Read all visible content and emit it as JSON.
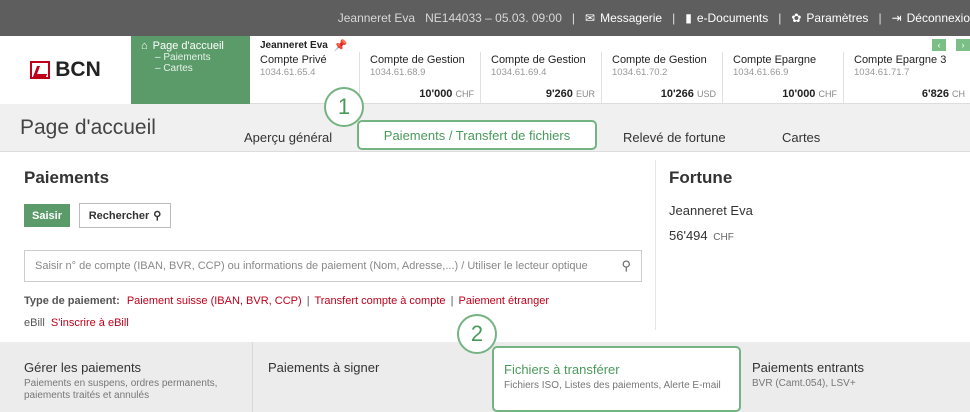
{
  "topbar": {
    "user": "Jeanneret Eva",
    "session": "NE144033 – 05.03. 09:00",
    "messaging": "Messagerie",
    "edocs": "e-Documents",
    "settings": "Paramètres",
    "logout": "Déconnexio"
  },
  "logo": {
    "text": "BCN"
  },
  "greennav": {
    "home": "Page d'accueil",
    "sub1": "– Paiements",
    "sub2": "– Cartes"
  },
  "accounts": {
    "holder": "Jeanneret Eva",
    "items": [
      {
        "name": "Compte Privé",
        "number": "1034.61.65.4",
        "balance": "",
        "currency": ""
      },
      {
        "name": "Compte de Gestion",
        "number": "1034.61.68.9",
        "balance": "10'000",
        "currency": "CHF"
      },
      {
        "name": "Compte de Gestion",
        "number": "1034.61.69.4",
        "balance": "9'260",
        "currency": "EUR"
      },
      {
        "name": "Compte de Gestion",
        "number": "1034.61.70.2",
        "balance": "10'266",
        "currency": "USD"
      },
      {
        "name": "Compte Epargne",
        "number": "1034.61.66.9",
        "balance": "10'000",
        "currency": "CHF"
      },
      {
        "name": "Compte Epargne 3",
        "number": "1034.61.71.7",
        "balance": "6'826",
        "currency": "CH"
      }
    ]
  },
  "page": {
    "title": "Page d'accueil",
    "tabs": {
      "overview": "Aperçu général",
      "payments": "Paiements / Transfert de fichiers",
      "wealth": "Relevé de fortune",
      "cards": "Cartes"
    }
  },
  "payments": {
    "heading": "Paiements",
    "saisir": "Saisir",
    "rechercher": "Rechercher",
    "search_placeholder": "Saisir n° de compte (IBAN, BVR, CCP) ou informations de paiement (Nom, Adresse,...) / Utiliser le lecteur optique",
    "type_label": "Type de paiement:",
    "type_swiss": "Paiement suisse (IBAN, BVR, CCP)",
    "type_transfer": "Transfert compte à compte",
    "type_foreign": "Paiement étranger",
    "ebill_label": "eBill",
    "ebill_link": "S'inscrire à eBill"
  },
  "fortune": {
    "heading": "Fortune",
    "name": "Jeanneret Eva",
    "value": "56'494",
    "currency": "CHF"
  },
  "cards": {
    "manage_title": "Gérer les paiements",
    "manage_sub1": "Paiements en suspens, ordres permanents,",
    "manage_sub2": "paiements traités et annulés",
    "sign_title": "Paiements à signer",
    "files_title": "Fichiers à transférer",
    "files_sub": "Fichiers ISO, Listes des paiements, Alerte E-mail",
    "incoming_title": "Paiements entrants",
    "incoming_sub": "BVR (Camt.054), LSV+"
  },
  "markers": {
    "one": "1",
    "two": "2"
  },
  "colors": {
    "green": "#5b9b6a",
    "red": "#c0001a",
    "topbar": "#5e5e5e"
  }
}
